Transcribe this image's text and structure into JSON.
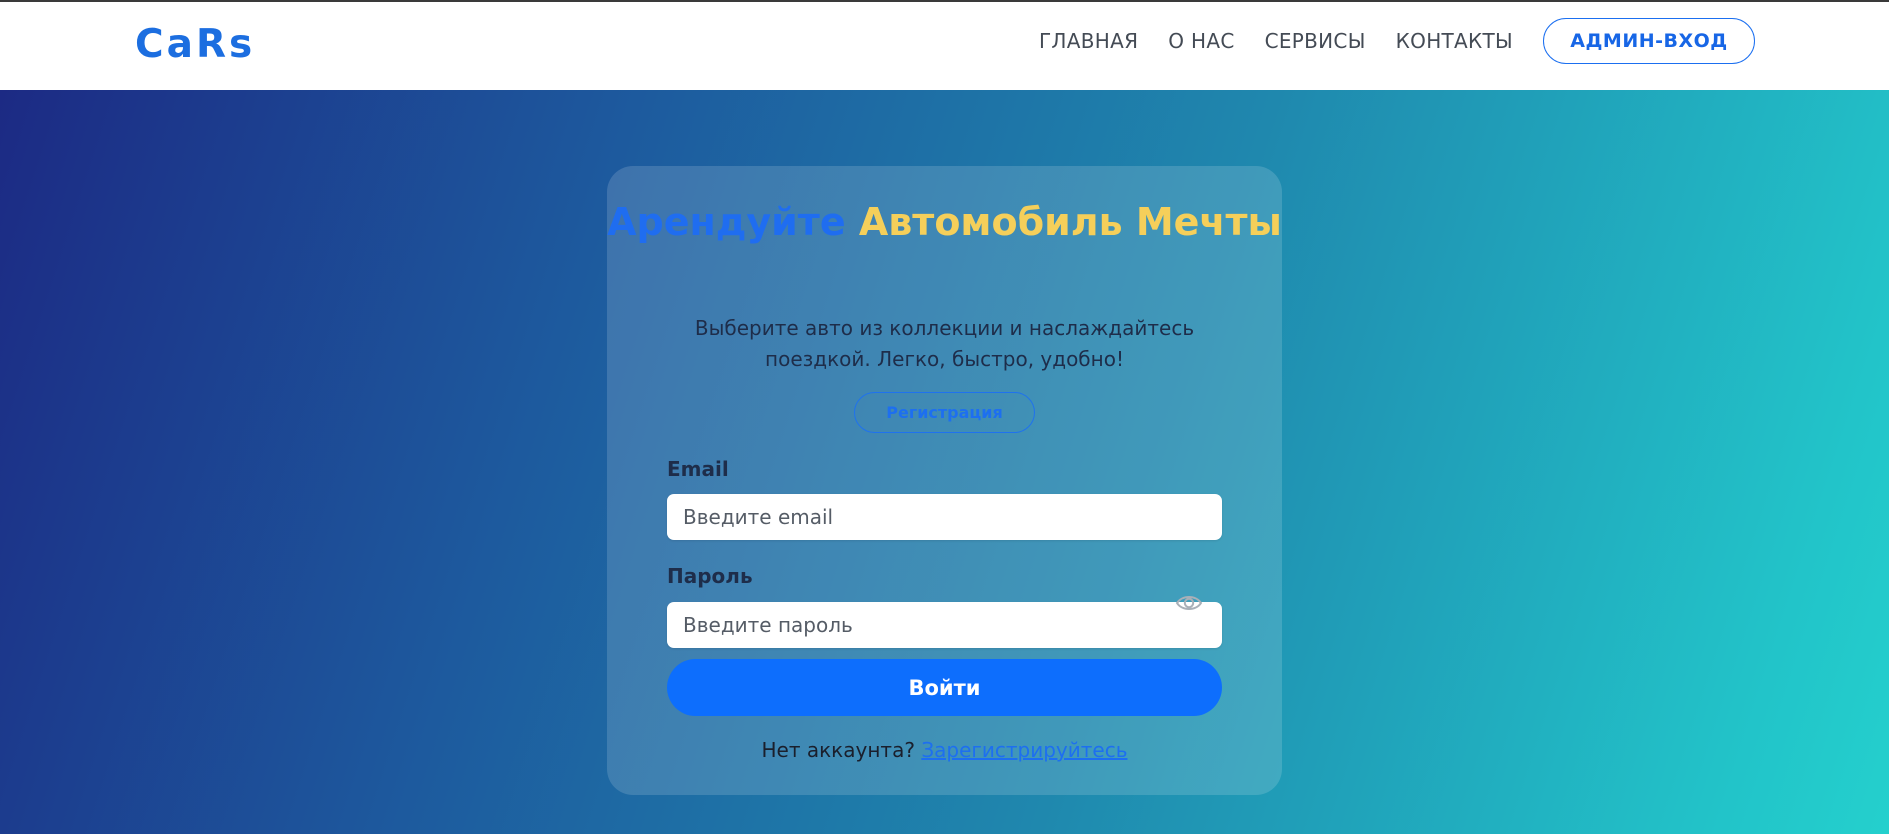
{
  "header": {
    "brand": "CaRs",
    "nav": [
      "ГЛАВНАЯ",
      "О НАС",
      "СЕРВИСЫ",
      "КОНТАКТЫ"
    ],
    "admin_label": "АДМИН-ВХОД"
  },
  "card": {
    "title_part1": "Арендуйте",
    "title_part2": "Автомобиль Мечты",
    "subtitle": "Выберите авто из коллекции и наслаждайтесь поездкой. Легко, быстро, удобно!",
    "register_pill": "Регистрация",
    "email_label": "Email",
    "email_placeholder": "Введите email",
    "password_label": "Пароль",
    "password_placeholder": "Введите пароль",
    "login_button": "Войти",
    "no_account_text": "Нет аккаунта?",
    "register_link": "Зарегистрируйтесь"
  },
  "icons": {
    "password_toggle": "eye-icon"
  },
  "colors": {
    "accent": "#0d6efd",
    "brand": "#1c6ee0",
    "title_highlight": "#f5cf5a",
    "gradient_start": "#1c2a84",
    "gradient_end": "#24d0cd"
  }
}
